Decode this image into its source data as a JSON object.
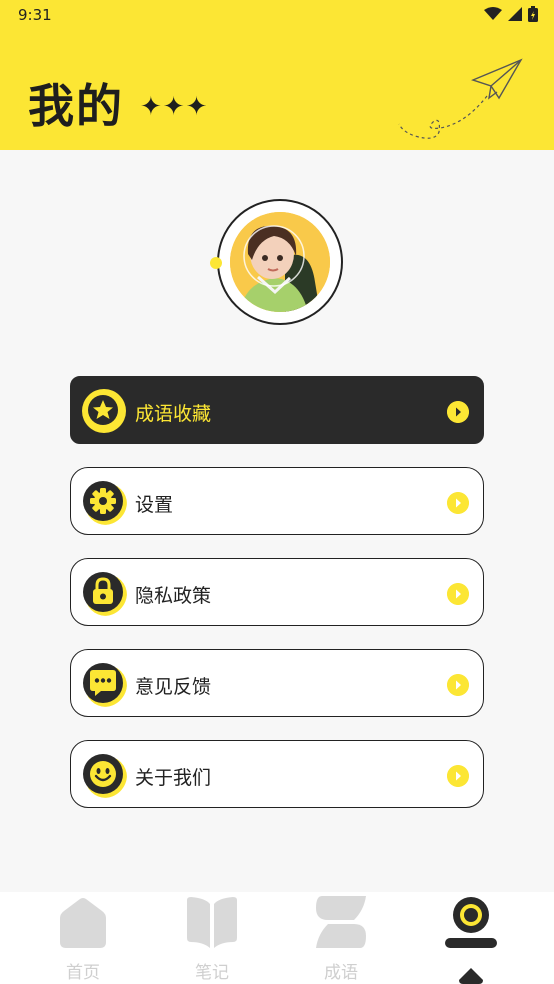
{
  "status_bar": {
    "time": "9:31"
  },
  "header": {
    "title": "我的",
    "stars": "✦✦✦"
  },
  "menu": [
    {
      "label": "成语收藏",
      "icon": "star-badge-icon",
      "active": true
    },
    {
      "label": "设置",
      "icon": "gear-icon",
      "active": false
    },
    {
      "label": "隐私政策",
      "icon": "lock-icon",
      "active": false
    },
    {
      "label": "意见反馈",
      "icon": "chat-bubble-icon",
      "active": false
    },
    {
      "label": "关于我们",
      "icon": "smiley-icon",
      "active": false
    }
  ],
  "tabs": [
    {
      "label": "首页",
      "icon": "home-icon",
      "active": false
    },
    {
      "label": "笔记",
      "icon": "book-icon",
      "active": false
    },
    {
      "label": "成语",
      "icon": "idiom-icon",
      "active": false
    },
    {
      "label": "",
      "icon": "profile-icon",
      "active": true
    }
  ],
  "colors": {
    "accent": "#fce634",
    "dark": "#2a2a2a",
    "inactive": "#cfcfcf"
  }
}
